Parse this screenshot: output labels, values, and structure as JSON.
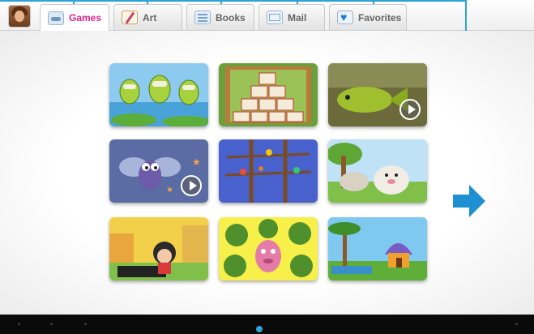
{
  "tabs": [
    {
      "label": "Games",
      "icon": "game-controller-icon",
      "active": true
    },
    {
      "label": "Art",
      "icon": "paintbrush-icon",
      "active": false
    },
    {
      "label": "Books",
      "icon": "book-icon",
      "active": false
    },
    {
      "label": "Mail",
      "icon": "mail-icon",
      "active": false
    },
    {
      "label": "Favorites",
      "icon": "heart-icon",
      "active": false
    }
  ],
  "colors": {
    "active_tab_text": "#e0208a",
    "accent": "#2aa3d6",
    "arrow": "#1e8fd0",
    "system_bar": "#0a0a0a"
  },
  "thumbnails": [
    {
      "scene": "frogs-at-pond"
    },
    {
      "scene": "stacked-blocks-puzzle"
    },
    {
      "scene": "fish-underwater",
      "has_play": true
    },
    {
      "scene": "bug-character",
      "has_play": true
    },
    {
      "scene": "birds-on-branches"
    },
    {
      "scene": "hamster-in-garden"
    },
    {
      "scene": "girl-in-city"
    },
    {
      "scene": "creature-in-broccoli"
    },
    {
      "scene": "house-in-jungle"
    }
  ]
}
